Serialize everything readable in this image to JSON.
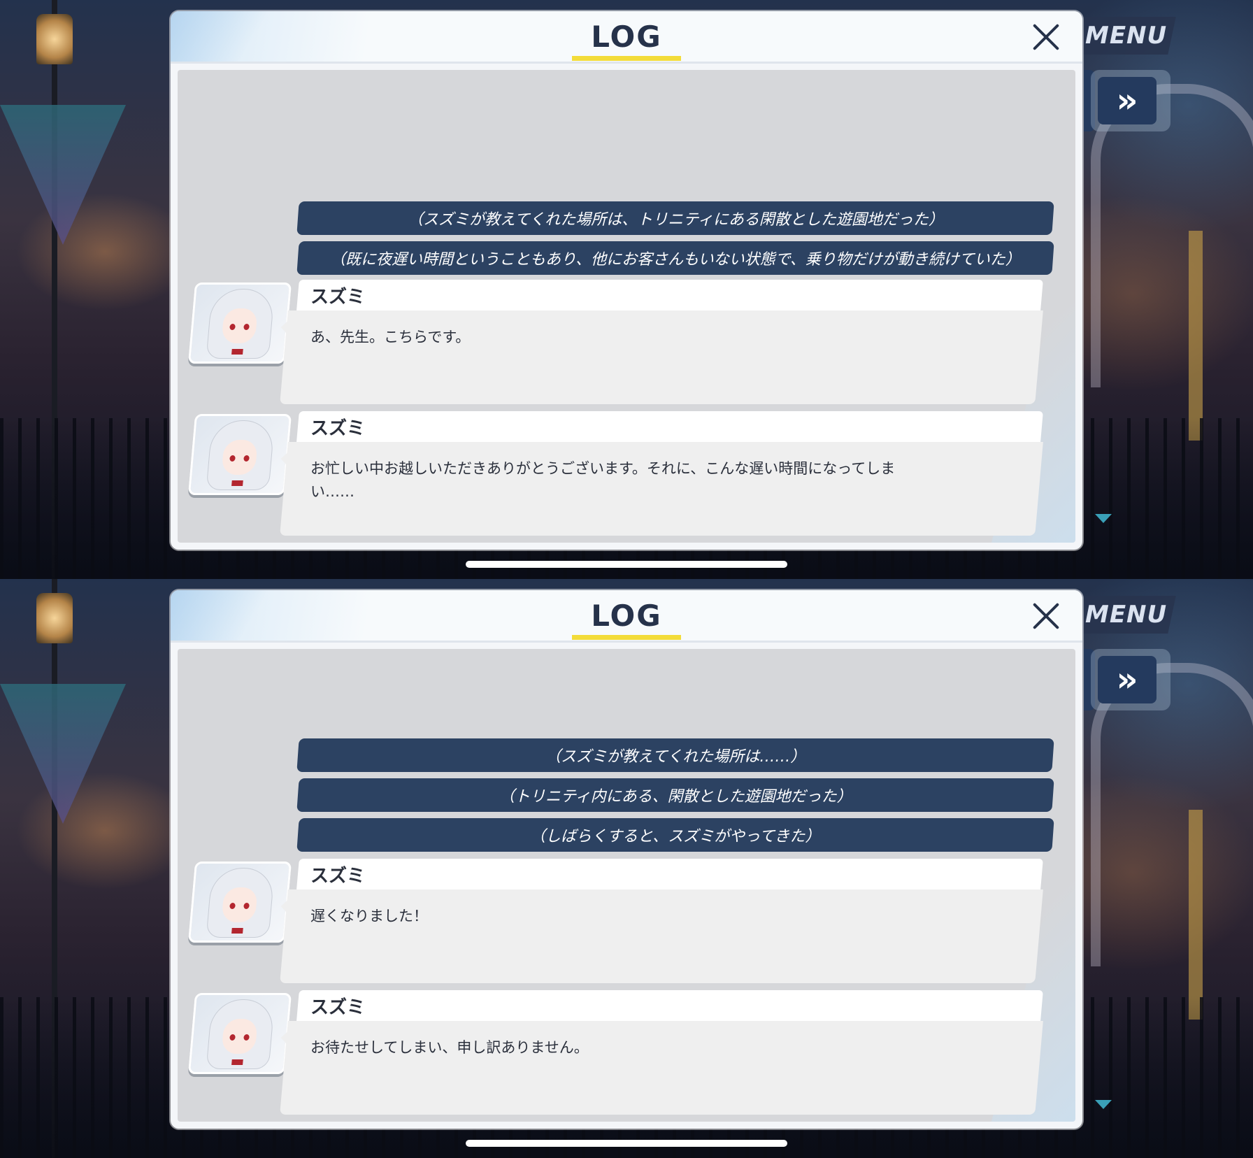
{
  "screens": [
    {
      "menu_label": "MENU",
      "skip_icon": "»",
      "log_title": "LOG",
      "narrations": [
        "（スズミが教えてくれた場所は、トリニティにある閑散とした遊園地だった）",
        "（既に夜遅い時間ということもあり、他にお客さんもいない状態で、乗り物だけが動き続けていた）"
      ],
      "entries": [
        {
          "name": "スズミ",
          "text": "あ、先生。こちらです。"
        },
        {
          "name": "スズミ",
          "text": "お忙しい中お越しいただきありがとうございます。それに、こんな遅い時間になってしまい……"
        }
      ]
    },
    {
      "menu_label": "MENU",
      "skip_icon": "»",
      "log_title": "LOG",
      "narrations": [
        "（スズミが教えてくれた場所は……）",
        "（トリニティ内にある、閑散とした遊園地だった）",
        "（しばらくすると、スズミがやってきた）"
      ],
      "entries": [
        {
          "name": "スズミ",
          "text": "遅くなりました！"
        },
        {
          "name": "スズミ",
          "text": "お待たせしてしまい、申し訳ありません。"
        }
      ]
    }
  ],
  "icons": {
    "close": "close-icon",
    "skip": "fast-forward-icon",
    "scroll": "scroll-down-arrow-icon"
  },
  "colors": {
    "narration_bg": "#2c4262",
    "title_underline": "#f3dc3a",
    "title_text": "#26324a"
  }
}
